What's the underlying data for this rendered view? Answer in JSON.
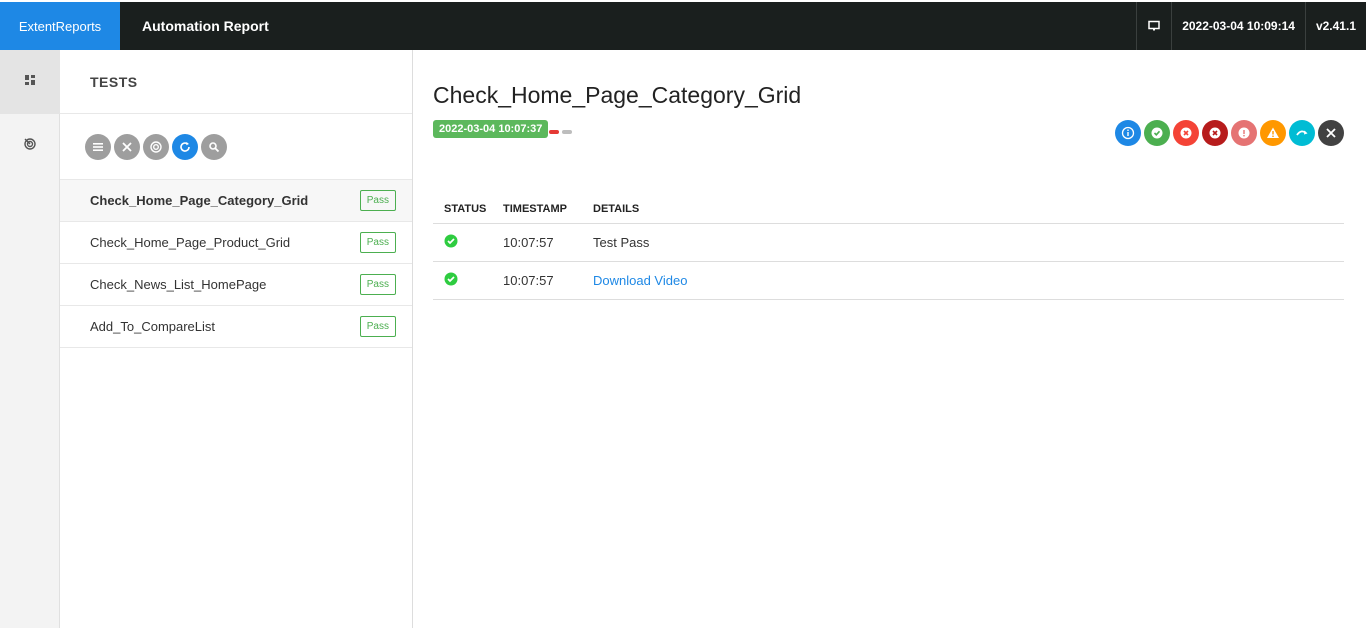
{
  "header": {
    "brand": "ExtentReports",
    "report_name": "Automation Report",
    "datetime": "2022-03-04 10:09:14",
    "version": "v2.41.1"
  },
  "nav": {
    "items": [
      {
        "icon": "dashboard-icon",
        "active": true
      },
      {
        "icon": "category-icon",
        "active": false
      }
    ]
  },
  "tests_panel": {
    "title": "TESTS",
    "filters": [
      "list-icon",
      "close-icon",
      "target-icon",
      "refresh-icon",
      "search-icon"
    ],
    "tests": [
      {
        "name": "Check_Home_Page_Category_Grid",
        "status": "Pass"
      },
      {
        "name": "Check_Home_Page_Product_Grid",
        "status": "Pass"
      },
      {
        "name": "Check_News_List_HomePage",
        "status": "Pass"
      },
      {
        "name": "Add_To_CompareList",
        "status": "Pass"
      }
    ]
  },
  "detail": {
    "title": "Check_Home_Page_Category_Grid",
    "start_time": "2022-03-04 10:07:37",
    "status_filters": [
      {
        "name": "info-icon",
        "color": "#1e88e5"
      },
      {
        "name": "pass-icon",
        "color": "#4caf50"
      },
      {
        "name": "fail-icon",
        "color": "#f44336"
      },
      {
        "name": "fatal-icon",
        "color": "#b71c1c"
      },
      {
        "name": "error-icon",
        "color": "#e57373"
      },
      {
        "name": "warning-icon",
        "color": "#ff9800"
      },
      {
        "name": "skip-icon",
        "color": "#00bcd4"
      },
      {
        "name": "clear-icon",
        "color": "#424242"
      }
    ],
    "columns": {
      "status": "STATUS",
      "timestamp": "TIMESTAMP",
      "details": "DETAILS"
    },
    "logs": [
      {
        "timestamp": "10:07:57",
        "details": "Test Pass"
      },
      {
        "timestamp": "10:07:57",
        "details": "Download Video"
      }
    ]
  }
}
